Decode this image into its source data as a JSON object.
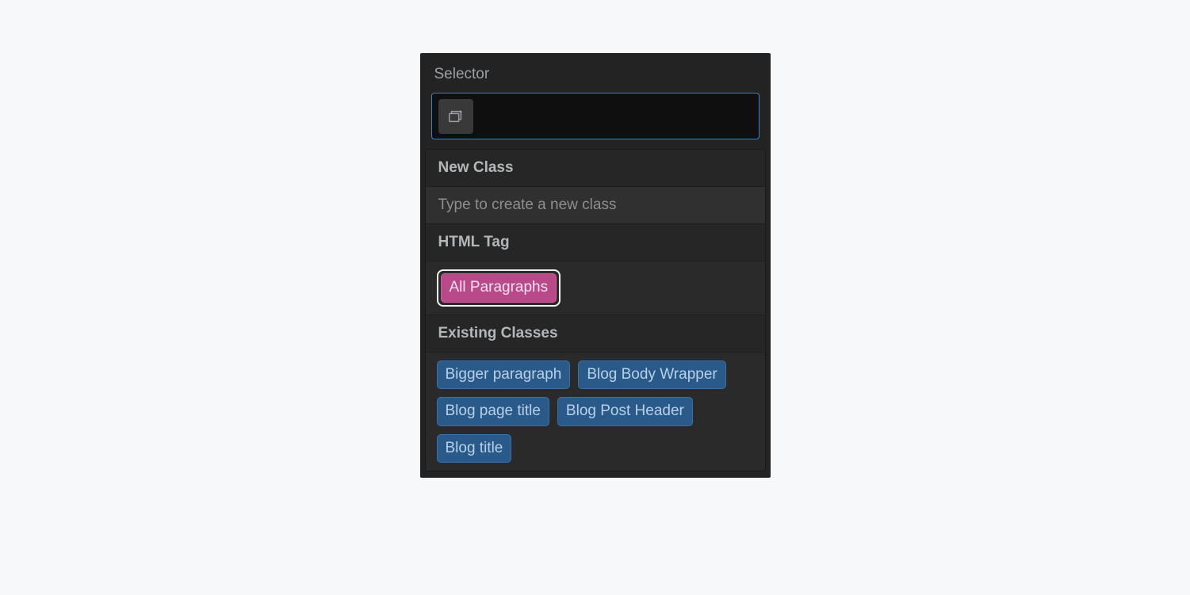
{
  "selector": {
    "title": "Selector",
    "input_value": ""
  },
  "dropdown": {
    "new_class": {
      "header": "New Class",
      "hint": "Type to create a new class"
    },
    "html_tag": {
      "header": "HTML Tag",
      "items": [
        "All Paragraphs"
      ]
    },
    "existing_classes": {
      "header": "Existing Classes",
      "items": [
        "Bigger paragraph",
        "Blog Body Wrapper",
        "Blog page title",
        "Blog Post Header",
        "Blog title"
      ]
    }
  }
}
